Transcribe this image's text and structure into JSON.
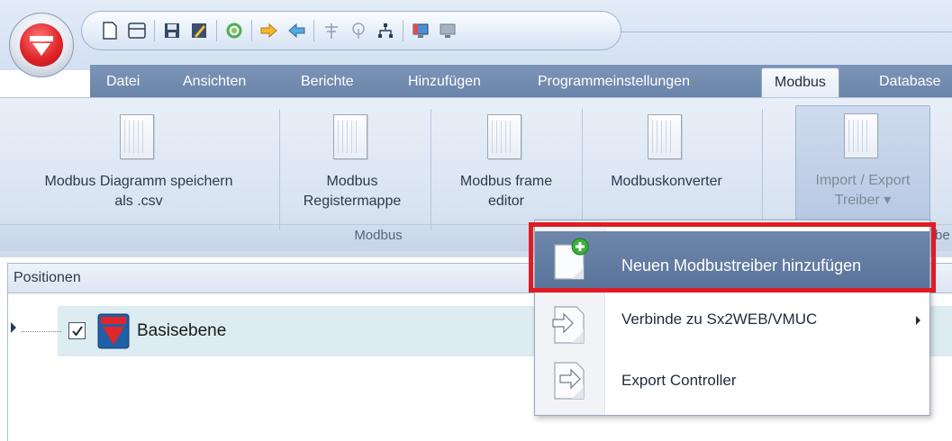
{
  "qat": {
    "icons": [
      "new-document-icon",
      "print-icon",
      "save-icon",
      "edit-icon",
      "refresh-icon",
      "import-arrow-icon",
      "export-arrow-icon",
      "antenna-icon",
      "wireless-icon",
      "network-icon",
      "monitor-icon",
      "display-icon"
    ]
  },
  "tabs": [
    {
      "label": "Datei"
    },
    {
      "label": "Ansichten"
    },
    {
      "label": "Berichte"
    },
    {
      "label": "Hinzufügen"
    },
    {
      "label": "Programmeinstellungen"
    },
    {
      "label": "Modbus",
      "active": true
    },
    {
      "label": "Database"
    }
  ],
  "ribbon": {
    "buttons": [
      {
        "label_line1": "Modbus Diagramm speichern",
        "label_line2": "als .csv"
      },
      {
        "label_line1": "Modbus",
        "label_line2": "Registermappe"
      },
      {
        "label_line1": "Modbus frame",
        "label_line2": "editor"
      },
      {
        "label_line1": "Modbuskonverter",
        "label_line2": ""
      },
      {
        "label_line1": "Import / Export",
        "label_line2": "Treiber ▾"
      }
    ],
    "group_label": "Modbus",
    "group_label_right": "be"
  },
  "panel": {
    "title": "Positionen",
    "tree": {
      "node_label": "Basisebene",
      "checked": true
    }
  },
  "menu": {
    "items": [
      {
        "label": "Neuen Modbustreiber hinzufügen",
        "icon": "add-document-icon",
        "highlighted": true
      },
      {
        "label": "Verbinde zu Sx2WEB/VMUC",
        "icon": "connect-document-icon",
        "has_submenu": true
      },
      {
        "label": "Export Controller",
        "icon": "export-document-icon"
      }
    ]
  },
  "colors": {
    "tab_bar": "#6a83a8",
    "highlight_border": "#e01b24",
    "menu_hover": "#5a739a",
    "brand_red": "#e0262b"
  }
}
